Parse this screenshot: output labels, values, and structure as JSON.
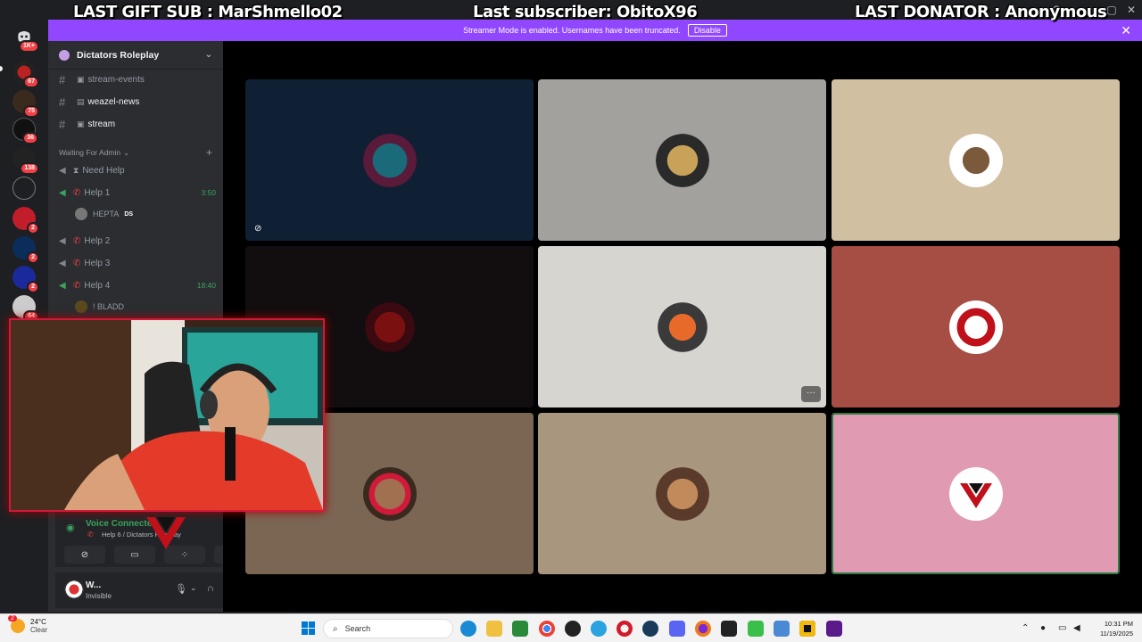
{
  "overlay": {
    "last_gift_sub": "LAST GIFT SUB : MarShmello02",
    "last_subscriber": "Last subscriber: ObitoX96",
    "last_donator": "LAST DONATOR : Anonymous"
  },
  "banner": {
    "message": "Streamer Mode is enabled. Usernames have been truncated.",
    "disable_label": "Disable",
    "color": "#9146ff"
  },
  "server_rail": {
    "home_badge": "1K+",
    "badges": [
      "67",
      "75",
      "36",
      "138",
      "2",
      "2",
      "2",
      "64"
    ]
  },
  "sidebar": {
    "guild_name": "Dictators Roleplay",
    "channels": [
      {
        "name": "stream-events"
      },
      {
        "name": "weazel-news"
      },
      {
        "name": "stream"
      }
    ],
    "category": "Waiting For Admin",
    "voice_channels": [
      {
        "name": "Need Help",
        "time": ""
      },
      {
        "name": "Help 1",
        "time": "3:50"
      },
      {
        "name": "Help 2",
        "time": ""
      },
      {
        "name": "Help 3",
        "time": ""
      },
      {
        "name": "Help 4",
        "time": "18:40"
      }
    ],
    "voice_users": [
      {
        "name": "HEPTA",
        "tag": "DS"
      },
      {
        "name": "! BLADD",
        "tag": ""
      }
    ]
  },
  "voice_panel": {
    "status": "Voice Connected",
    "location": "Help 6 / Dictators Roleplay"
  },
  "user_panel": {
    "name": "W...",
    "status": "Invisible"
  },
  "taskbar": {
    "weather_temp": "24°C",
    "weather_condition": "Clear",
    "weather_badge": "2",
    "search_placeholder": "Search",
    "time": "10:31 PM",
    "date": "11/19/2025"
  },
  "colors": {
    "accent_green": "#3ba55c",
    "danger_red": "#f23f43",
    "tile_colors": [
      "#0f2035",
      "#a3a19e",
      "#d1bfa2",
      "#120d0e",
      "#d7d5d0",
      "#a64d44",
      "#7b6654",
      "#a9967f",
      "#e09bb2"
    ]
  }
}
